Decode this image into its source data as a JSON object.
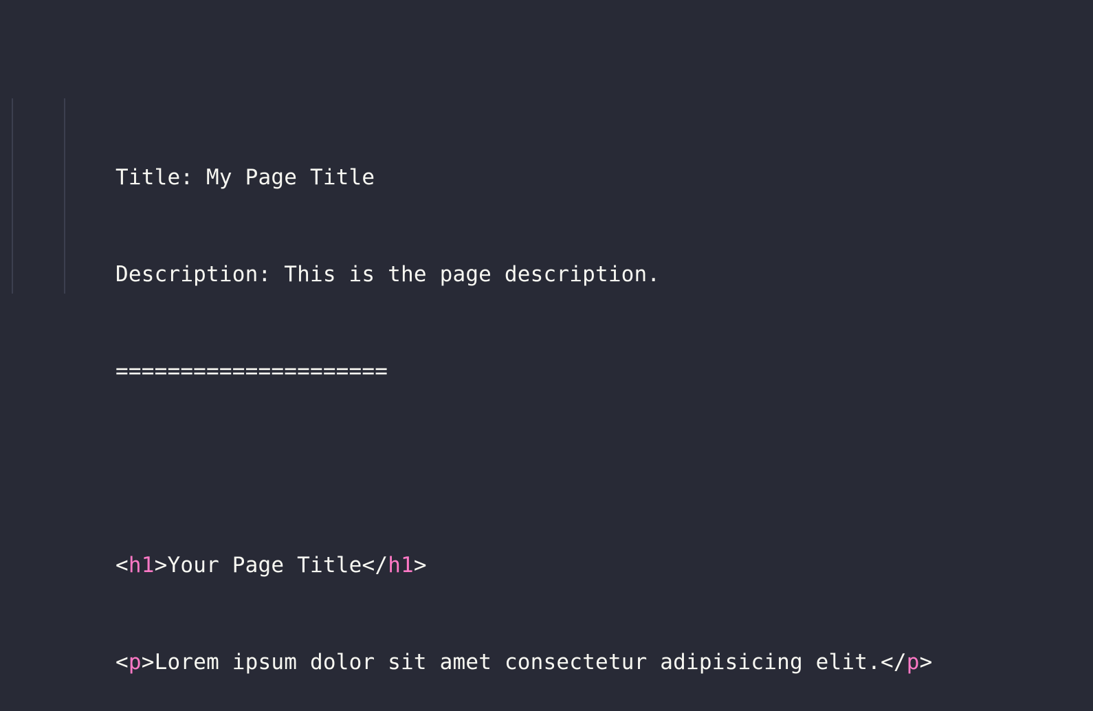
{
  "colors": {
    "background": "#282a36",
    "text": "#f8f8f2",
    "tag_name": "#ff79c6",
    "indent_guide": "#3c3f4f"
  },
  "code": {
    "lines": [
      {
        "text": "Title: My Page Title"
      },
      {
        "text": "Description: This is the page description."
      },
      {
        "text": "====================="
      },
      {
        "text": ""
      },
      {
        "open_lt": "<",
        "open_tag": "h1",
        "open_gt": ">",
        "content": "Your Page Title",
        "close_lt": "</",
        "close_tag": "h1",
        "close_gt": ">"
      },
      {
        "open_lt": "<",
        "open_tag": "p",
        "open_gt": ">",
        "content": "Lorem ipsum dolor sit amet consectetur adipisicing elit.",
        "close_lt": "</",
        "close_tag": "p",
        "close_gt": ">"
      }
    ]
  }
}
